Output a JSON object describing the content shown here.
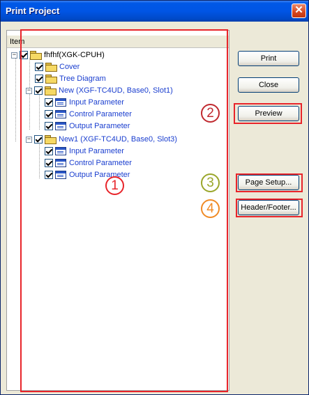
{
  "window": {
    "title": "Print Project",
    "close_glyph": "✕"
  },
  "list": {
    "header": "Item"
  },
  "tree": {
    "root": {
      "label": "fhfhf(XGK-CPUH)",
      "expander": "−"
    },
    "cover": {
      "label": "Cover"
    },
    "tree_diagram": {
      "label": "Tree Diagram"
    },
    "new_module": {
      "label": "New (XGF-TC4UD, Base0, Slot1)",
      "expander": "−"
    },
    "new_input": {
      "label": "Input Parameter"
    },
    "new_control": {
      "label": "Control Parameter"
    },
    "new_output": {
      "label": "Output Parameter"
    },
    "new1_module": {
      "label": "New1 (XGF-TC4UD, Base0, Slot3)",
      "expander": "−"
    },
    "new1_input": {
      "label": "Input Parameter"
    },
    "new1_control": {
      "label": "Control Parameter"
    },
    "new1_output": {
      "label": "Output Parameter"
    }
  },
  "buttons": {
    "print": "Print",
    "close": "Close",
    "preview": "Preview",
    "page_setup": "Page Setup...",
    "header_footer": "Header/Footer..."
  },
  "markers": {
    "m1": {
      "label": "1",
      "color": "#e8242a"
    },
    "m2": {
      "label": "2",
      "color": "#c0292f"
    },
    "m3": {
      "label": "3",
      "color": "#9aa62a"
    },
    "m4": {
      "label": "4",
      "color": "#f08a24"
    }
  },
  "colors": {
    "accent_red": "#e8242a",
    "tree_label_blue": "#1a3ecf",
    "titlebar_blue": "#0055e5"
  }
}
